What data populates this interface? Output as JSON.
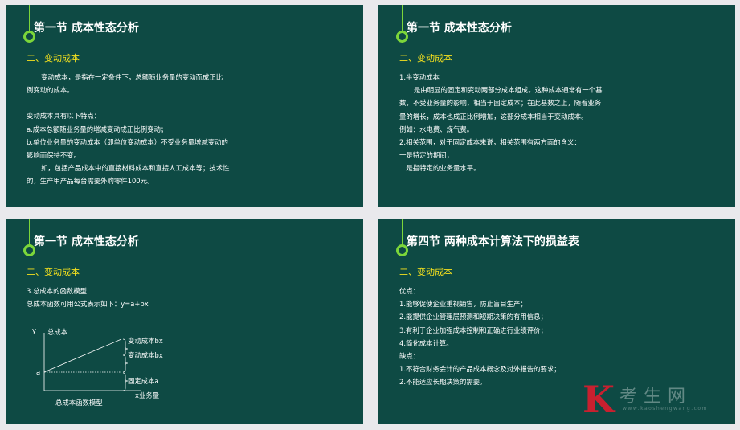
{
  "colors": {
    "slide_bg": "#0e4a44",
    "accent_green": "#7cd63a",
    "subtitle_yellow": "#f5e11e",
    "text": "#ffffff",
    "watermark_red": "#c8202f"
  },
  "slide1": {
    "title": "第一节 成本性态分析",
    "subtitle": "二、变动成本",
    "lines": [
      "变动成本，是指在一定条件下，总额随业务量的变动而成正比",
      "例变动的成本。",
      "",
      "变动成本具有以下特点：",
      "a.成本总额随业务量的增减变动成正比例变动；",
      "b.单位业务量的变动成本（即单位变动成本）不受业务量增减变动的",
      "影响而保持不变。",
      "如，包括产品成本中的直接材料成本和直接人工成本等；技术性",
      "的，生产甲产品每台需要外购零件100元。"
    ]
  },
  "slide2": {
    "title": "第一节 成本性态分析",
    "subtitle": "二、变动成本",
    "lines": [
      "1.半变动成本",
      "是由明显的固定和变动两部分成本组成。这种成本通常有一个基",
      "数，不受业务量的影响，相当于固定成本；在此基数之上，随着业务",
      "量的增长，成本也成正比例增加，这部分成本相当于变动成本。",
      "例如：水电费、煤气费。",
      "2.相关范围，对于固定成本来说，相关范围有两方面的含义：",
      "一是特定的期间，",
      "二是指特定的业务量水平。"
    ]
  },
  "slide3": {
    "title": "第一节 成本性态分析",
    "subtitle": "二、变动成本",
    "lines": [
      "3.总成本的函数模型",
      "总成本函数可用公式表示如下：y=a+bx"
    ],
    "diagram": {
      "y_axis_label": "y",
      "y_axis_name": "总成本",
      "a_label": "a",
      "label_variable_top": "变动成本bx",
      "label_variable_mid": "变动成本bx",
      "label_fixed": "固定成本a",
      "x_axis_label": "x业务量",
      "caption": "总成本函数模型"
    }
  },
  "slide4": {
    "title": "第四节 两种成本计算法下的损益表",
    "subtitle": "二、变动成本",
    "lines": [
      "优点：",
      "1.能够促使企业重视销售，防止盲目生产；",
      "2.能提供企业管理层预测和短期决策的有用信息；",
      "3.有利于企业加强成本控制和正确进行业绩评价；",
      "4.简化成本计算。",
      "缺点：",
      "1.不符合财务会计的产品成本概念及对外报告的要求；",
      "2.不能适应长期决策的需要。"
    ]
  },
  "watermark": {
    "mark": "K",
    "text": "考生网",
    "url": "www.kaoshengwang.com"
  }
}
